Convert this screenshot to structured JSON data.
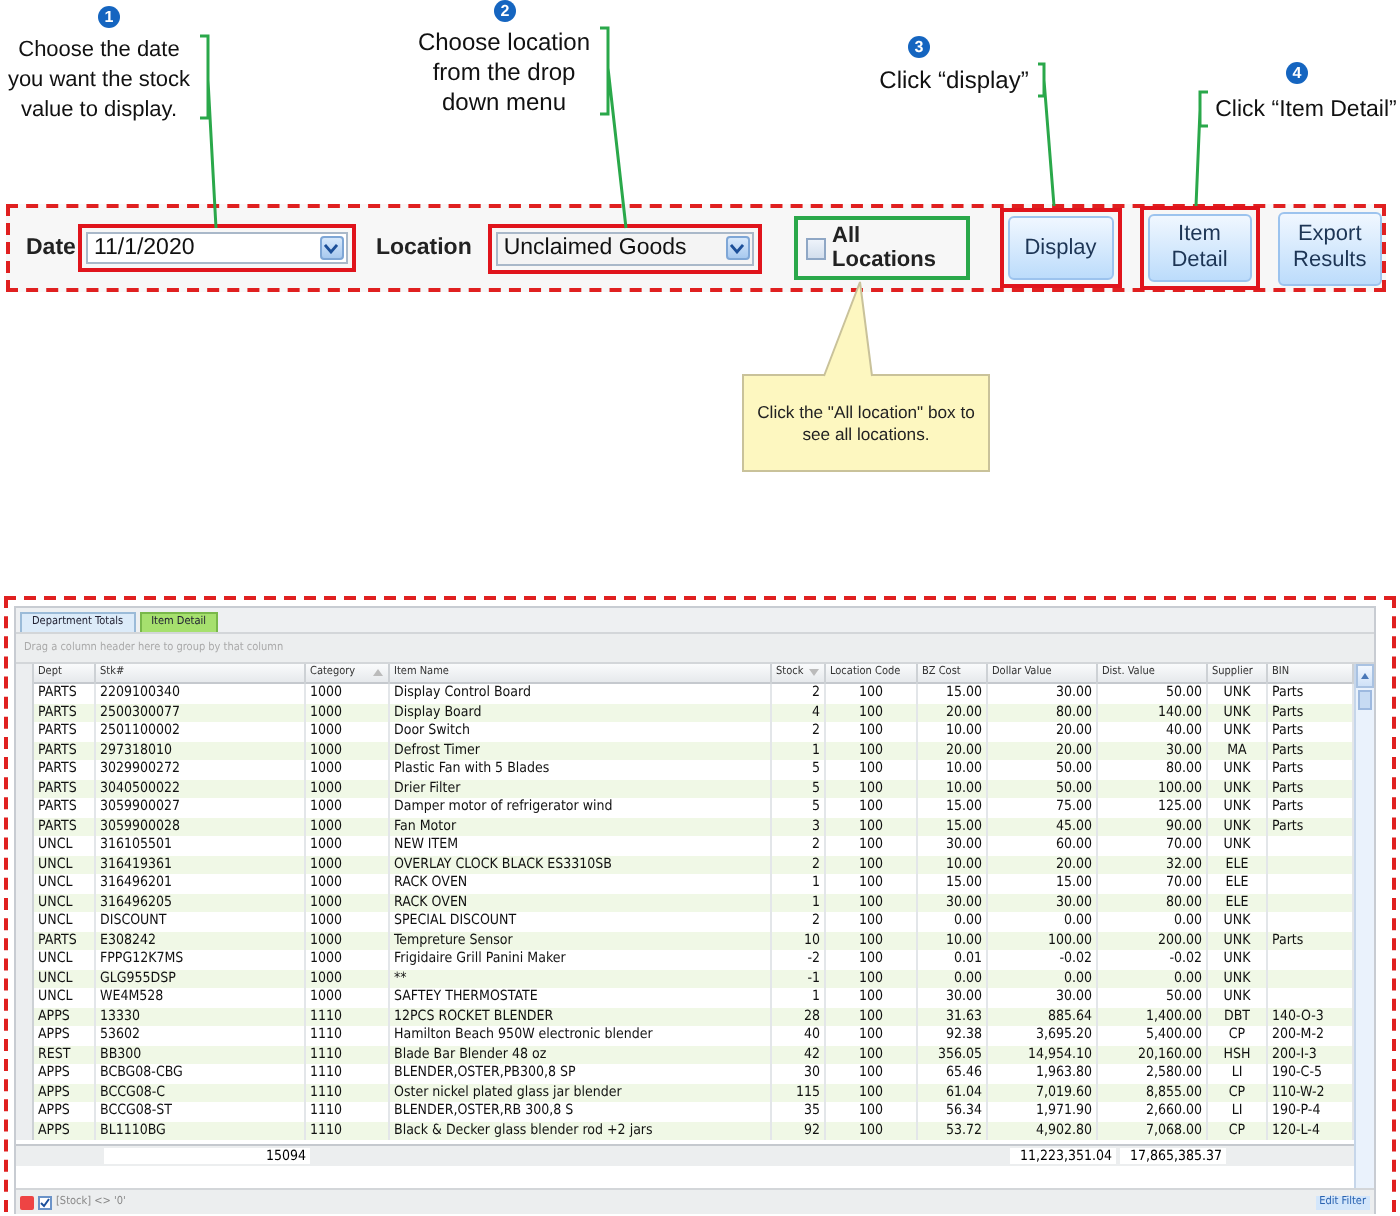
{
  "callouts": [
    {
      "number": "1",
      "text": "Choose the date you want the stock value to display."
    },
    {
      "number": "2",
      "text": "Choose location from the drop down menu"
    },
    {
      "number": "3",
      "text": "Click “display”"
    },
    {
      "number": "4",
      "text": "Click “Item Detail”"
    }
  ],
  "toolbar": {
    "date_label": "Date",
    "date_value": "11/1/2020",
    "location_label": "Location",
    "location_value": "Unclaimed Goods",
    "all_locations": {
      "label": "All Locations",
      "checked": false
    },
    "buttons": [
      "Display",
      "Item Detail",
      "Export Results"
    ]
  },
  "tooltip": "Click the \"All location\" box to see all locations.",
  "grid": {
    "tabs": [
      {
        "label": "Department Totals",
        "selected": false
      },
      {
        "label": "Item Detail",
        "selected": true
      }
    ],
    "group_hint": "Drag a column header here to group by that column",
    "columns": [
      {
        "label": "Dept",
        "sorted": false
      },
      {
        "label": "Stk#",
        "sorted": false
      },
      {
        "label": "Category",
        "sorted": true,
        "descending": false
      },
      {
        "label": "Item Name",
        "sorted": false
      },
      {
        "label": "Stock",
        "sorted": true,
        "descending": true
      },
      {
        "label": "Location Code",
        "sorted": false
      },
      {
        "label": "BZ Cost",
        "sorted": false
      },
      {
        "label": "Dollar Value",
        "sorted": false
      },
      {
        "label": "Dist. Value",
        "sorted": false
      },
      {
        "label": "Supplier",
        "sorted": false
      },
      {
        "label": "BIN",
        "sorted": false
      }
    ],
    "rows": [
      [
        "PARTS",
        "2209100340",
        "1000",
        "Display Control Board",
        "2",
        "100",
        "15.00",
        "30.00",
        "50.00",
        "UNK",
        "Parts"
      ],
      [
        "PARTS",
        "2500300077",
        "1000",
        "Display Board",
        "4",
        "100",
        "20.00",
        "80.00",
        "140.00",
        "UNK",
        "Parts"
      ],
      [
        "PARTS",
        "2501100002",
        "1000",
        "Door Switch",
        "2",
        "100",
        "10.00",
        "20.00",
        "40.00",
        "UNK",
        "Parts"
      ],
      [
        "PARTS",
        "297318010",
        "1000",
        "Defrost Timer",
        "1",
        "100",
        "20.00",
        "20.00",
        "30.00",
        "MA",
        "Parts"
      ],
      [
        "PARTS",
        "3029900272",
        "1000",
        "Plastic Fan with 5 Blades",
        "5",
        "100",
        "10.00",
        "50.00",
        "80.00",
        "UNK",
        "Parts"
      ],
      [
        "PARTS",
        "3040500022",
        "1000",
        "Drier Filter",
        "5",
        "100",
        "10.00",
        "50.00",
        "100.00",
        "UNK",
        "Parts"
      ],
      [
        "PARTS",
        "3059900027",
        "1000",
        "Damper motor of refrigerator wind",
        "5",
        "100",
        "15.00",
        "75.00",
        "125.00",
        "UNK",
        "Parts"
      ],
      [
        "PARTS",
        "3059900028",
        "1000",
        "Fan Motor",
        "3",
        "100",
        "15.00",
        "45.00",
        "90.00",
        "UNK",
        "Parts"
      ],
      [
        "UNCL",
        "316105501",
        "1000",
        "NEW ITEM",
        "2",
        "100",
        "30.00",
        "60.00",
        "70.00",
        "UNK",
        ""
      ],
      [
        "UNCL",
        "316419361",
        "1000",
        "OVERLAY CLOCK BLACK ES3310SB",
        "2",
        "100",
        "10.00",
        "20.00",
        "32.00",
        "ELE",
        ""
      ],
      [
        "UNCL",
        "316496201",
        "1000",
        "RACK OVEN",
        "1",
        "100",
        "15.00",
        "15.00",
        "70.00",
        "ELE",
        ""
      ],
      [
        "UNCL",
        "316496205",
        "1000",
        "RACK OVEN",
        "1",
        "100",
        "30.00",
        "30.00",
        "80.00",
        "ELE",
        ""
      ],
      [
        "UNCL",
        "DISCOUNT",
        "1000",
        "SPECIAL DISCOUNT",
        "2",
        "100",
        "0.00",
        "0.00",
        "0.00",
        "UNK",
        ""
      ],
      [
        "PARTS",
        "E308242",
        "1000",
        "Tempreture Sensor",
        "10",
        "100",
        "10.00",
        "100.00",
        "200.00",
        "UNK",
        "Parts"
      ],
      [
        "UNCL",
        "FPPG12K7MS",
        "1000",
        "Frigidaire Grill Panini Maker",
        "-2",
        "100",
        "0.01",
        "-0.02",
        "-0.02",
        "UNK",
        ""
      ],
      [
        "UNCL",
        "GLG955DSP",
        "1000",
        "**",
        "-1",
        "100",
        "0.00",
        "0.00",
        "0.00",
        "UNK",
        ""
      ],
      [
        "UNCL",
        "WE4M528",
        "1000",
        "SAFTEY THERMOSTATE",
        "1",
        "100",
        "30.00",
        "30.00",
        "50.00",
        "UNK",
        ""
      ],
      [
        "APPS",
        "13330",
        "1110",
        "12PCS ROCKET BLENDER",
        "28",
        "100",
        "31.63",
        "885.64",
        "1,400.00",
        "DBT",
        "140-O-3"
      ],
      [
        "APPS",
        "53602",
        "1110",
        "Hamilton Beach 950W electronic blender",
        "40",
        "100",
        "92.38",
        "3,695.20",
        "5,400.00",
        "CP",
        "200-M-2"
      ],
      [
        "REST",
        "BB300",
        "1110",
        "Blade Bar Blender 48 oz",
        "42",
        "100",
        "356.05",
        "14,954.10",
        "20,160.00",
        "HSH",
        "200-I-3"
      ],
      [
        "APPS",
        "BCBG08-CBG",
        "1110",
        "BLENDER,OSTER,PB300,8  SP",
        "30",
        "100",
        "65.46",
        "1,963.80",
        "2,580.00",
        "LI",
        "190-C-5"
      ],
      [
        "APPS",
        "BCCG08-C",
        "1110",
        "Oster nickel plated glass jar blender",
        "115",
        "100",
        "61.04",
        "7,019.60",
        "8,855.00",
        "CP",
        "110-W-2"
      ],
      [
        "APPS",
        "BCCG08-ST",
        "1110",
        "BLENDER,OSTER,RB 300,8  S",
        "35",
        "100",
        "56.34",
        "1,971.90",
        "2,660.00",
        "LI",
        "190-P-4"
      ],
      [
        "APPS",
        "BL1110BG",
        "1110",
        "Black & Decker glass blender rod +2 jars",
        "92",
        "100",
        "53.72",
        "4,902.80",
        "7,068.00",
        "CP",
        "120-L-4"
      ]
    ],
    "totals": {
      "stock": "15094",
      "dollar_value": "11,223,351.04",
      "dist_value": "17,865,385.37"
    },
    "filter": {
      "enabled": true,
      "text": "[Stock] <> '0'",
      "edit_label": "Edit Filter"
    }
  }
}
